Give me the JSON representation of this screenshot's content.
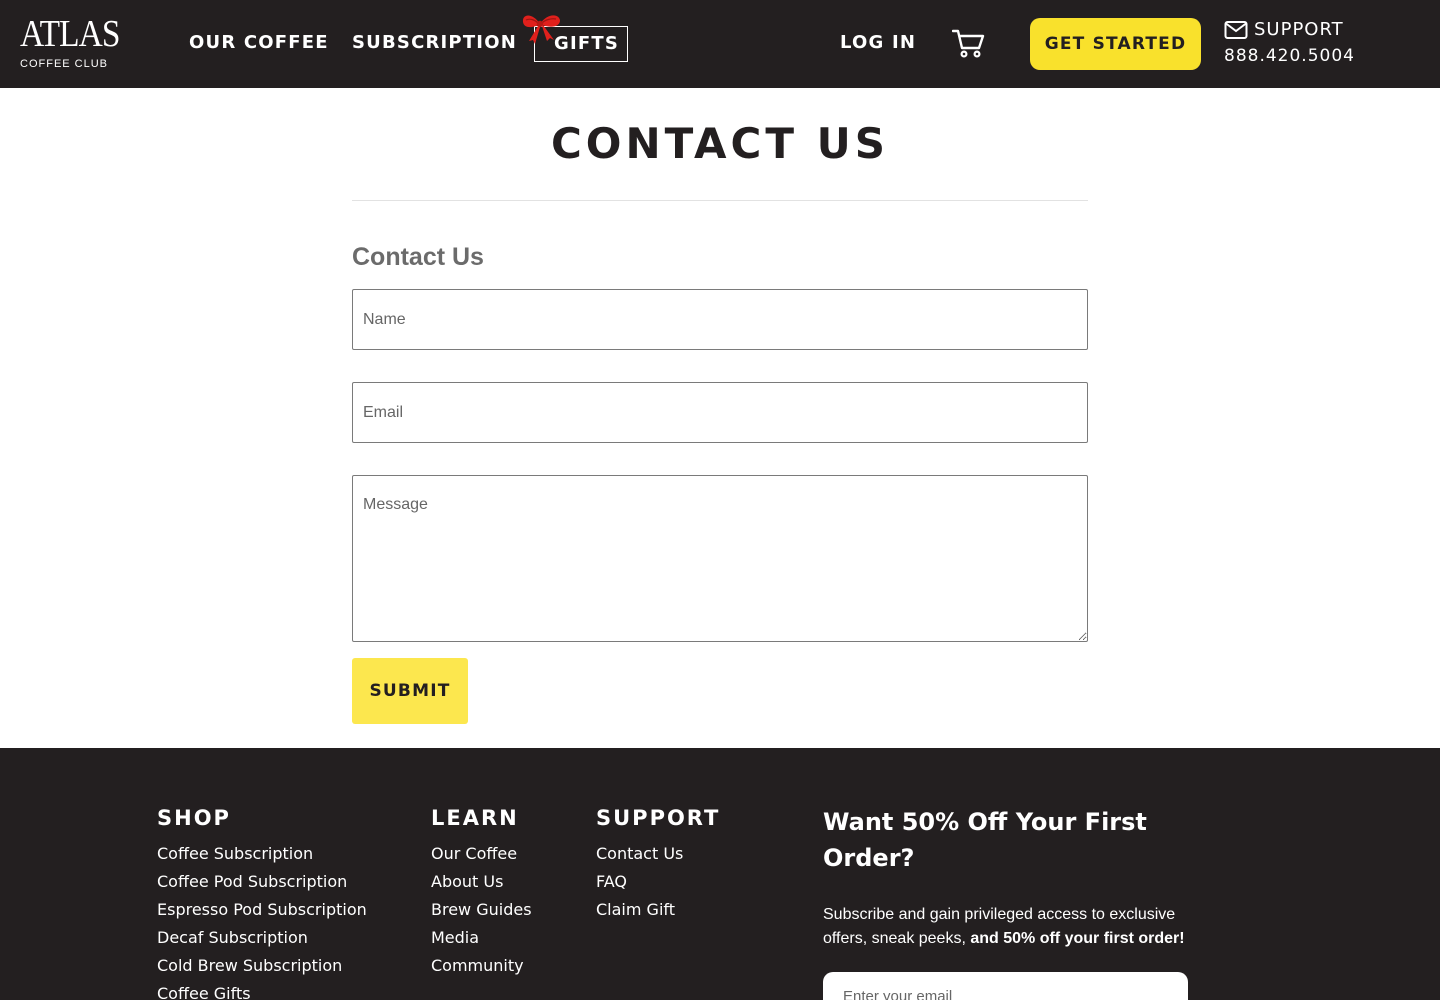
{
  "header": {
    "logo_main": "ATLAS",
    "logo_sub": "COFFEE CLUB",
    "nav": {
      "our_coffee": "OUR COFFEE",
      "subscription": "SUBSCRIPTION",
      "gifts": "GIFTS",
      "log_in": "LOG IN"
    },
    "get_started": "GET STARTED",
    "support_label": "SUPPORT",
    "support_phone": "888.420.5004"
  },
  "main": {
    "page_title": "CONTACT US",
    "form_heading": "Contact Us",
    "name_placeholder": "Name",
    "email_placeholder": "Email",
    "message_placeholder": "Message",
    "submit_label": "SUBMIT"
  },
  "footer": {
    "shop": {
      "heading": "SHOP",
      "links": [
        "Coffee Subscription",
        "Coffee Pod Subscription",
        "Espresso Pod Subscription",
        "Decaf Subscription",
        "Cold Brew Subscription",
        "Coffee Gifts"
      ]
    },
    "learn": {
      "heading": "LEARN",
      "links": [
        "Our Coffee",
        "About Us",
        "Brew Guides",
        "Media",
        "Community"
      ]
    },
    "support": {
      "heading": "SUPPORT",
      "links": [
        "Contact Us",
        "FAQ",
        "Claim Gift"
      ]
    },
    "promo": {
      "heading": "Want 50% Off Your First Order?",
      "text": "Subscribe and gain privileged access to exclusive offers, sneak peeks, ",
      "text_bold": "and 50% off your first order!",
      "email_placeholder": "Enter your email"
    }
  },
  "colors": {
    "header_bg": "#231f20",
    "accent_yellow": "#f9e12c",
    "bow_red": "#e0201c"
  },
  "icons": [
    "bow-icon",
    "cart-icon",
    "mail-icon"
  ]
}
